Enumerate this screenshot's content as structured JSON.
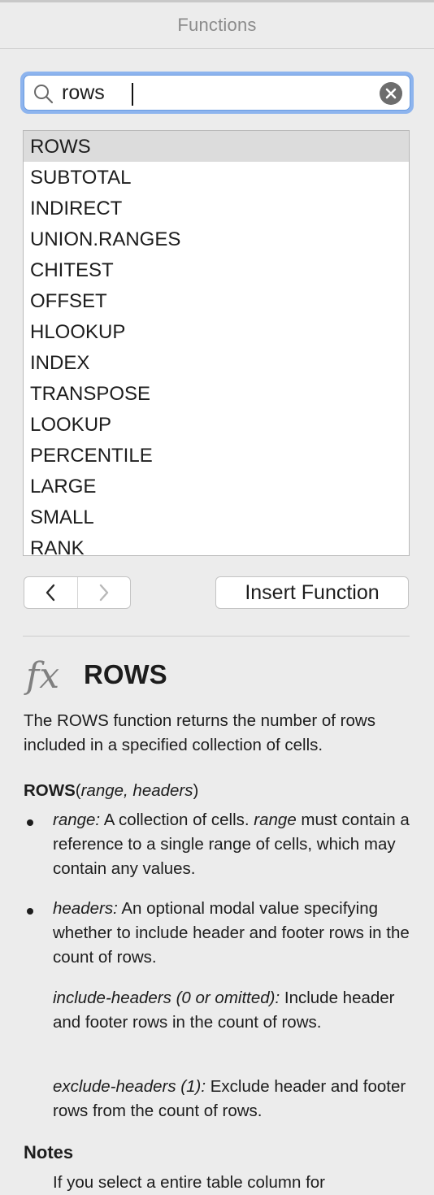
{
  "panel": {
    "title": "Functions"
  },
  "search": {
    "value": "rows",
    "placeholder": ""
  },
  "functions": [
    "ROWS",
    "SUBTOTAL",
    "INDIRECT",
    "UNION.RANGES",
    "CHITEST",
    "OFFSET",
    "HLOOKUP",
    "INDEX",
    "TRANSPOSE",
    "LOOKUP",
    "PERCENTILE",
    "LARGE",
    "SMALL",
    "RANK"
  ],
  "selected_function": "ROWS",
  "buttons": {
    "insert_function": "Insert Function"
  },
  "detail": {
    "name": "ROWS",
    "fx_symbol": "fx",
    "description": "The ROWS function returns the number of rows included in a specified collection of cells.",
    "syntax": {
      "name": "ROWS",
      "args": "range, headers"
    },
    "arguments": {
      "range_term": "range:",
      "range_text_1": " A collection of cells. ",
      "range_term_inline": "range",
      "range_text_2": " must contain a reference to a single range of cells, which may contain any values.",
      "headers_term": "headers:",
      "headers_text": " An optional modal value specifying whether to include header and footer rows in the count of rows.",
      "include_term": "include-headers (0 or omitted):",
      "include_text": " Include header and footer rows in the count of rows.",
      "exclude_term": "exclude-headers (1):",
      "exclude_text": " Exclude header and footer rows from the count of rows."
    },
    "notes_title": "Notes",
    "notes_first": "If you select a entire table column for"
  },
  "colors": {
    "focus_ring": "#8db4ee",
    "selected_row": "#dcdcdc",
    "panel_bg": "#ececec"
  }
}
